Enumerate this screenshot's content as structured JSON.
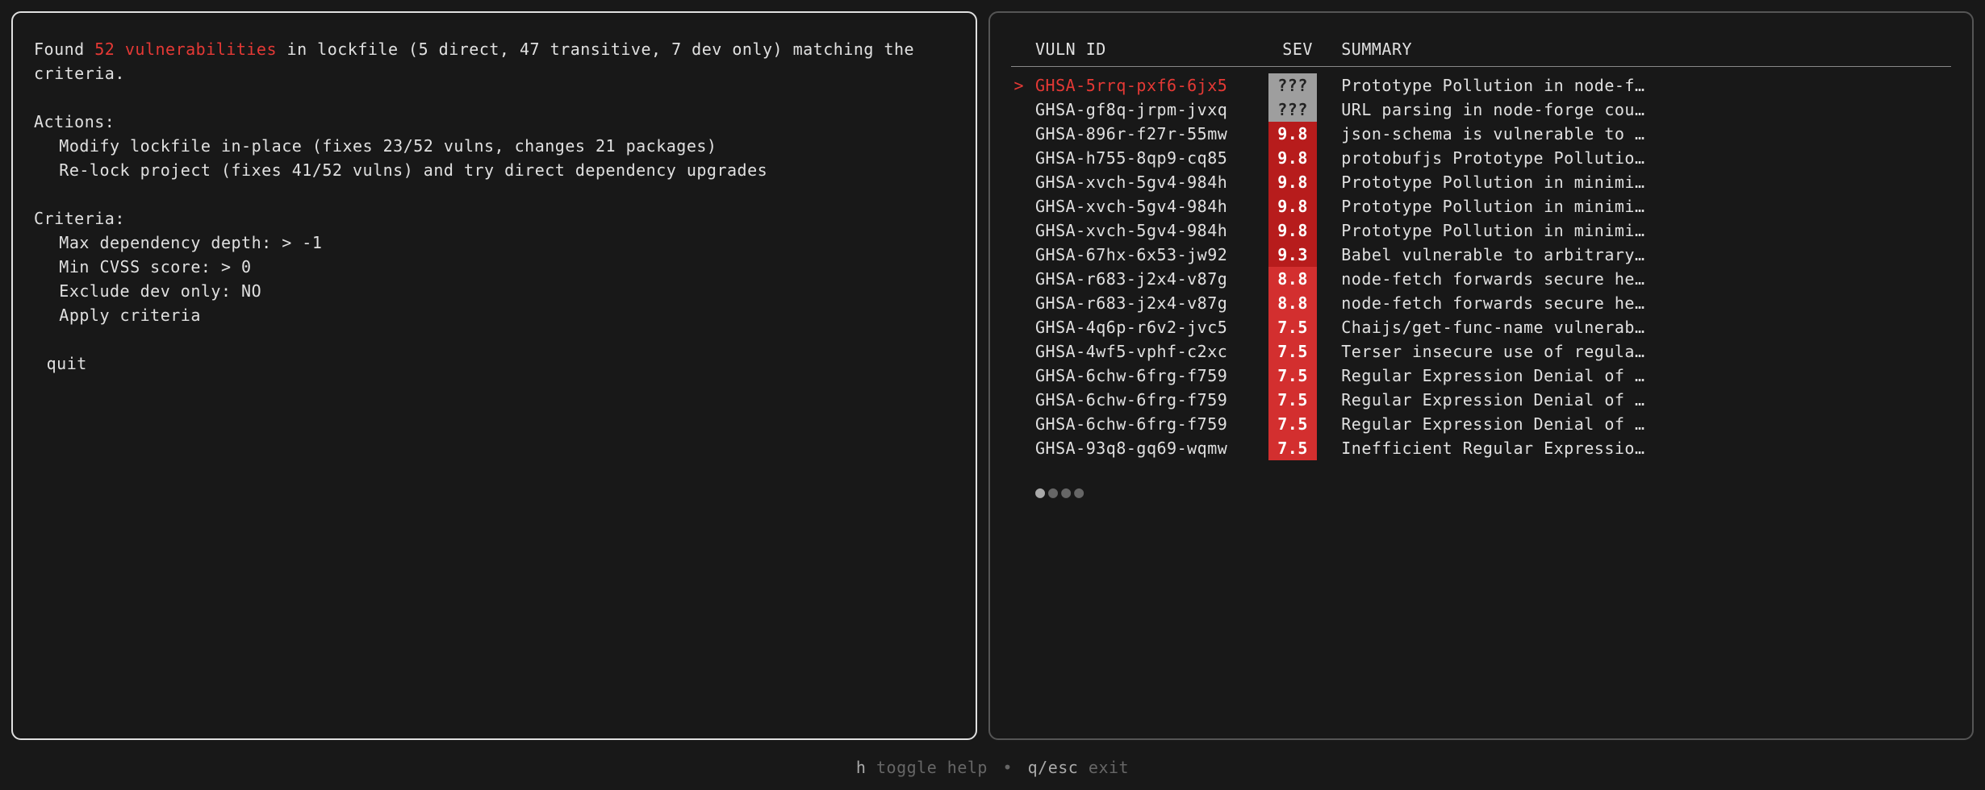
{
  "summary": {
    "prefix": "Found ",
    "count_text": "52 vulnerabilities",
    "suffix": " in lockfile (5 direct, 47 transitive, 7 dev only) matching the criteria."
  },
  "actions": {
    "label": "Actions:",
    "items": [
      "Modify lockfile in-place (fixes 23/52 vulns, changes 21 packages)",
      "Re-lock project (fixes 41/52 vulns) and try direct dependency upgrades"
    ]
  },
  "criteria": {
    "label": "Criteria:",
    "items": [
      "Max dependency depth: > -1",
      "Min CVSS score: > 0",
      "Exclude dev only: NO",
      "Apply criteria"
    ]
  },
  "quit_label": "quit",
  "table": {
    "headers": {
      "id": "VULN ID",
      "sev": "SEV",
      "summary": "SUMMARY"
    },
    "rows": [
      {
        "id": "GHSA-5rrq-pxf6-6jx5",
        "sev": "???",
        "sev_class": "sev-unknown",
        "summary": "Prototype Pollution in node-f…",
        "selected": true
      },
      {
        "id": "GHSA-gf8q-jrpm-jvxq",
        "sev": "???",
        "sev_class": "sev-unknown",
        "summary": "URL parsing in node-forge cou…"
      },
      {
        "id": "GHSA-896r-f27r-55mw",
        "sev": "9.8",
        "sev_class": "sev-crit",
        "summary": "json-schema is vulnerable to …"
      },
      {
        "id": "GHSA-h755-8qp9-cq85",
        "sev": "9.8",
        "sev_class": "sev-crit",
        "summary": "protobufjs Prototype Pollutio…"
      },
      {
        "id": "GHSA-xvch-5gv4-984h",
        "sev": "9.8",
        "sev_class": "sev-crit",
        "summary": "Prototype Pollution in minimi…"
      },
      {
        "id": "GHSA-xvch-5gv4-984h",
        "sev": "9.8",
        "sev_class": "sev-crit",
        "summary": "Prototype Pollution in minimi…"
      },
      {
        "id": "GHSA-xvch-5gv4-984h",
        "sev": "9.8",
        "sev_class": "sev-crit",
        "summary": "Prototype Pollution in minimi…"
      },
      {
        "id": "GHSA-67hx-6x53-jw92",
        "sev": "9.3",
        "sev_class": "sev-crit",
        "summary": "Babel vulnerable to arbitrary…"
      },
      {
        "id": "GHSA-r683-j2x4-v87g",
        "sev": "8.8",
        "sev_class": "sev-high",
        "summary": "node-fetch forwards secure he…"
      },
      {
        "id": "GHSA-r683-j2x4-v87g",
        "sev": "8.8",
        "sev_class": "sev-high",
        "summary": "node-fetch forwards secure he…"
      },
      {
        "id": "GHSA-4q6p-r6v2-jvc5",
        "sev": "7.5",
        "sev_class": "sev-high",
        "summary": "Chaijs/get-func-name vulnerab…"
      },
      {
        "id": "GHSA-4wf5-vphf-c2xc",
        "sev": "7.5",
        "sev_class": "sev-high",
        "summary": "Terser insecure use of regula…"
      },
      {
        "id": "GHSA-6chw-6frg-f759",
        "sev": "7.5",
        "sev_class": "sev-high",
        "summary": "Regular Expression Denial of …"
      },
      {
        "id": "GHSA-6chw-6frg-f759",
        "sev": "7.5",
        "sev_class": "sev-high",
        "summary": "Regular Expression Denial of …"
      },
      {
        "id": "GHSA-6chw-6frg-f759",
        "sev": "7.5",
        "sev_class": "sev-high",
        "summary": "Regular Expression Denial of …"
      },
      {
        "id": "GHSA-93q8-gq69-wqmw",
        "sev": "7.5",
        "sev_class": "sev-high",
        "summary": "Inefficient Regular Expressio…"
      }
    ]
  },
  "footer": {
    "help_key": "h",
    "help_text": "toggle help",
    "quit_key": "q/esc",
    "quit_text": "exit"
  }
}
